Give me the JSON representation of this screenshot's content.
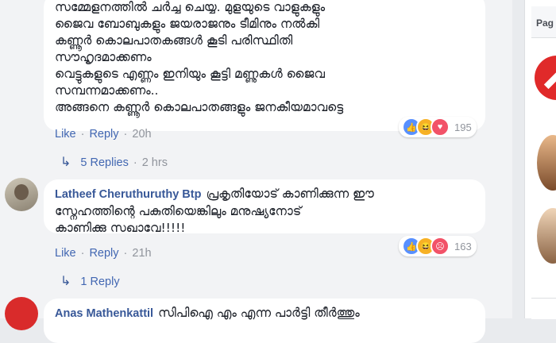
{
  "comments": [
    {
      "lines": [
        "സമ്മേളനത്തിൽ ചർച്ച ചെയ്യ. മുളയുടെ വാളുകളും",
        "ജൈവ ബോബുകളും ജയരാജനും ടീമിനും നൽകി",
        "കണ്ണൂർ കൊലപാതകങ്ങൾ കൂടി പരിസ്ഥിതി",
        "സൗഹൃദമാക്കണം",
        "വെട്ടുകളുടെ എണ്ണം ഇനിയും കൂട്ടി മണ്ണുകൾ ജൈവ",
        "സമ്പന്നമാക്കണം..",
        "അങ്ങനെ കണ്ണൂർ കൊലപാതങ്ങളും ജനകീയമാവട്ടെ"
      ],
      "like": "Like",
      "reply": "Reply",
      "time": "20h",
      "reaction_count": "195",
      "replies_label": "5 Replies",
      "replies_time": "2 hrs"
    },
    {
      "author": "Latheef Cheruthuruthy Btp",
      "lines": [
        "പ്രകൃതിയോട് കാണിക്കുന്ന ഈ",
        "സ്നേഹത്തിന്റെ പകുതിയെങ്കിലും മനുഷ്യനോട്",
        "കാണിക്കു സഖാവേ!!!!!"
      ],
      "like": "Like",
      "reply": "Reply",
      "time": "21h",
      "reaction_count": "163",
      "replies_label": "1 Reply"
    },
    {
      "author": "Anas Mathenkattil",
      "text": "സിപിഐ എം എന്ന പാർട്ടി തീർത്തും"
    }
  ],
  "sidebar": {
    "header": "Pag"
  }
}
